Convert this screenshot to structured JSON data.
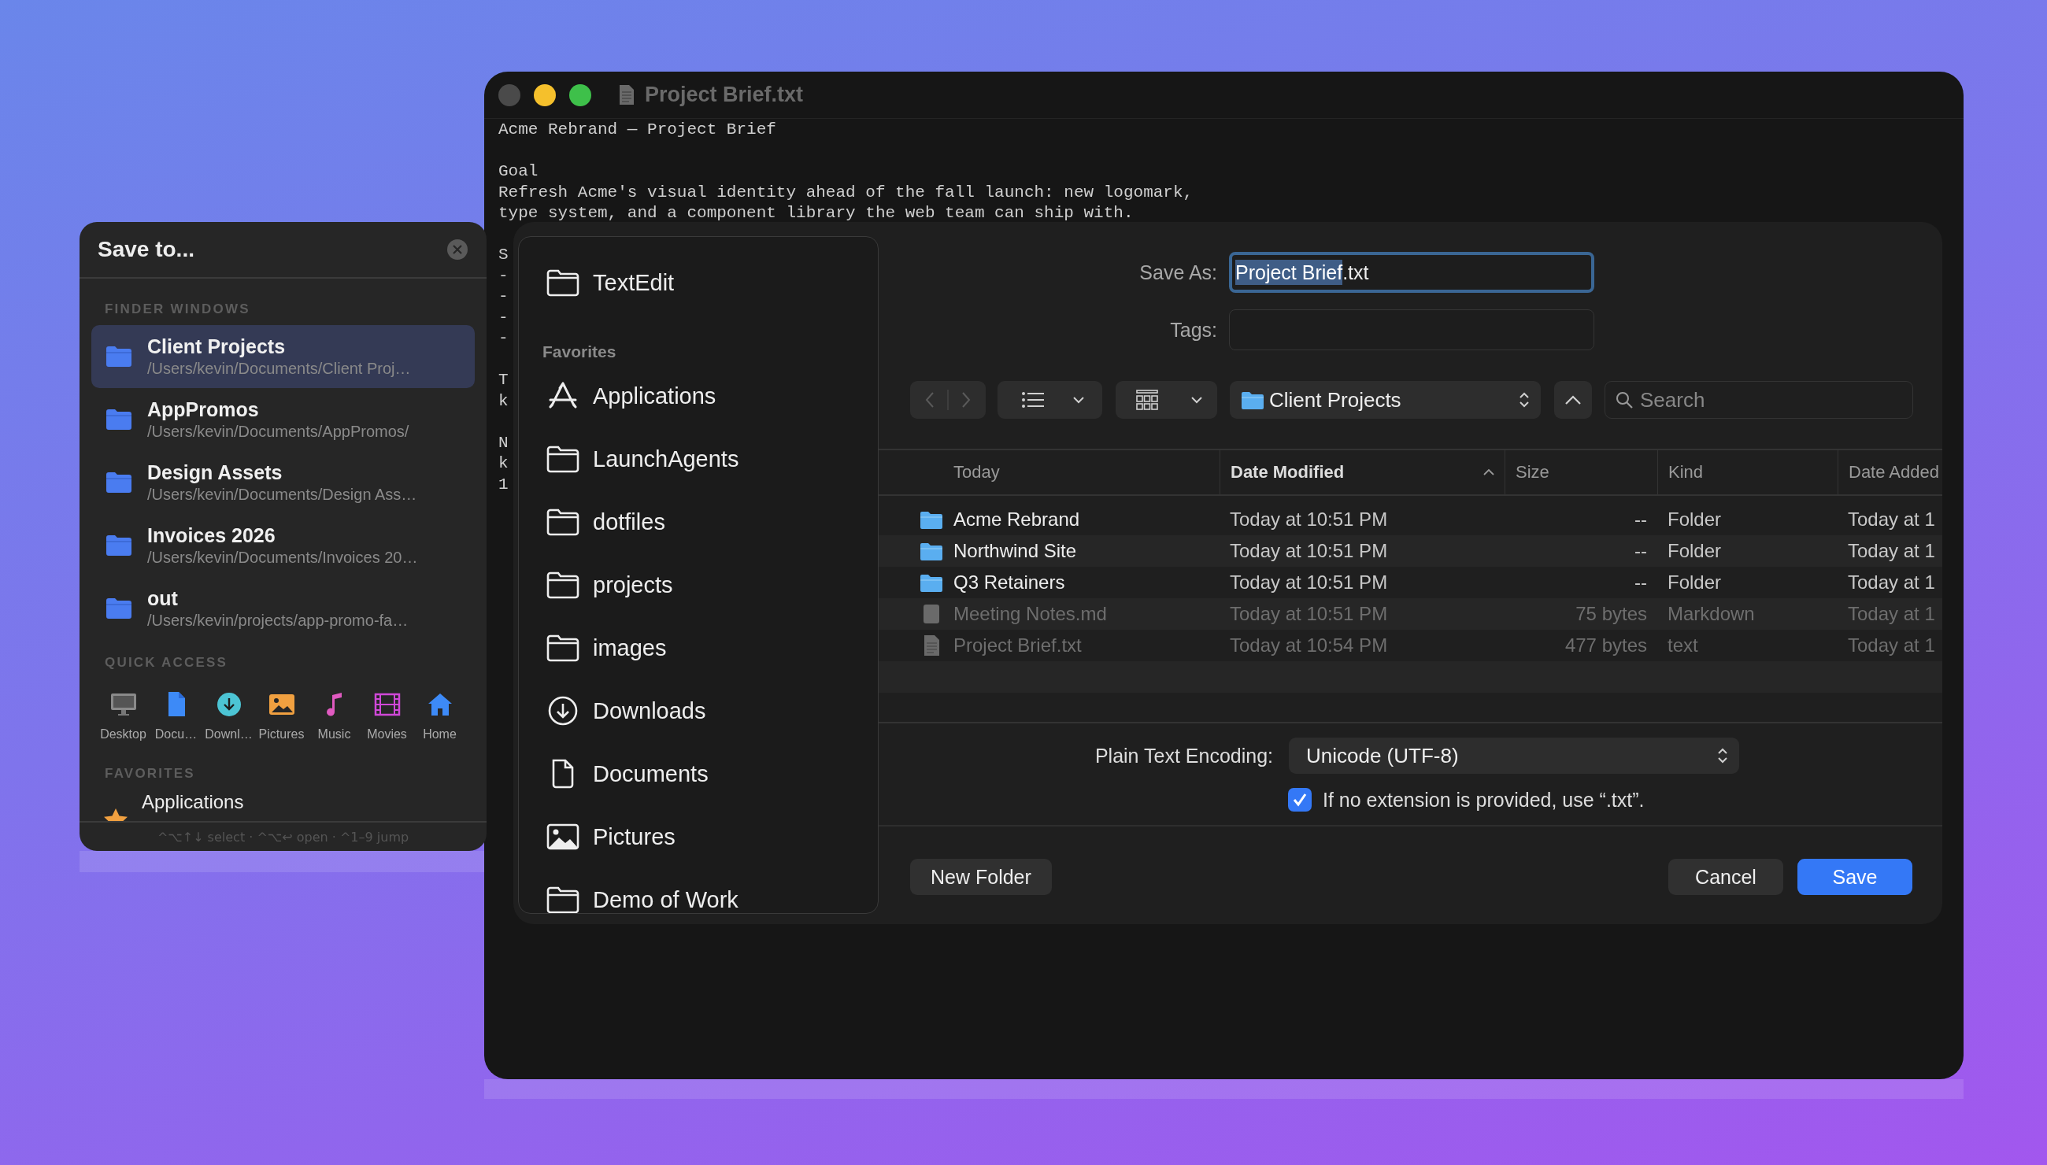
{
  "save_to_panel": {
    "title": "Save to...",
    "finder_windows": {
      "heading": "FINDER WINDOWS",
      "items": [
        {
          "name": "Client Projects",
          "path": "/Users/kevin/Documents/Client Proj…",
          "selected": true
        },
        {
          "name": "AppPromos",
          "path": "/Users/kevin/Documents/AppPromos/",
          "selected": false
        },
        {
          "name": "Design Assets",
          "path": "/Users/kevin/Documents/Design Ass…",
          "selected": false
        },
        {
          "name": "Invoices 2026",
          "path": "/Users/kevin/Documents/Invoices 20…",
          "selected": false
        },
        {
          "name": "out",
          "path": "/Users/kevin/projects/app-promo-fa…",
          "selected": false
        }
      ]
    },
    "quick_access": {
      "heading": "QUICK ACCESS",
      "items": [
        {
          "label": "Desktop",
          "kind": "desktop"
        },
        {
          "label": "Docu…",
          "kind": "documents"
        },
        {
          "label": "Downl…",
          "kind": "downloads"
        },
        {
          "label": "Pictures",
          "kind": "pictures"
        },
        {
          "label": "Music",
          "kind": "music"
        },
        {
          "label": "Movies",
          "kind": "movies"
        },
        {
          "label": "Home",
          "kind": "home"
        }
      ]
    },
    "favorites": {
      "heading": "FAVORITES",
      "items": [
        {
          "label": "Applications",
          "kind": "applications"
        }
      ]
    },
    "footer": "^⌥↑↓ select · ^⌥↩ open · ^1–9 jump"
  },
  "editor": {
    "traffic_lights": [
      {
        "color": "#4a4a4a"
      },
      {
        "color": "#f5c02c"
      },
      {
        "color": "#3ec04a"
      }
    ],
    "title": "Project Brief.txt",
    "paragraphs": [
      {
        "lines": [
          "Acme Rebrand — Project Brief"
        ]
      },
      {
        "lines": [
          "Goal",
          "Refresh Acme's visual identity ahead of the fall launch: new logomark,",
          "type system, and a component library the web team can ship with."
        ]
      },
      {
        "lines": [
          "S",
          "-",
          "-",
          "-",
          "-"
        ]
      },
      {
        "lines": [
          "T",
          "k"
        ]
      },
      {
        "lines": [
          "N",
          "k",
          "1"
        ]
      }
    ]
  },
  "save_sheet": {
    "sidebar": {
      "top_items": [
        {
          "label": "TextEdit",
          "kind": "folder"
        }
      ],
      "favorites": {
        "heading": "Favorites",
        "items": [
          {
            "label": "Applications",
            "kind": "applications"
          },
          {
            "label": "LaunchAgents",
            "kind": "folder"
          },
          {
            "label": "dotfiles",
            "kind": "folder"
          },
          {
            "label": "projects",
            "kind": "folder"
          },
          {
            "label": "images",
            "kind": "folder"
          },
          {
            "label": "Downloads",
            "kind": "downloads"
          },
          {
            "label": "Documents",
            "kind": "document"
          },
          {
            "label": "Pictures",
            "kind": "pictures"
          },
          {
            "label": "Demo of Work",
            "kind": "folder"
          }
        ]
      }
    },
    "save_as": {
      "label": "Save As:",
      "focused": true,
      "value_parts": [
        {
          "text": "Project Brief",
          "selected": true
        },
        {
          "text": ".txt",
          "selected": false
        }
      ]
    },
    "tags": {
      "label": "Tags:"
    },
    "toolbar": {
      "back_disabled": true,
      "forward_disabled": true,
      "location": "Client Projects",
      "search_placeholder": "Search"
    },
    "file_list": {
      "columns": [
        {
          "label": "Today",
          "sorted": false
        },
        {
          "label": "Date Modified",
          "sorted": true
        },
        {
          "label": "Size",
          "sorted": false
        },
        {
          "label": "Kind",
          "sorted": false
        },
        {
          "label": "Date Added",
          "sorted": false
        }
      ],
      "rows": [
        {
          "name": "Acme Rebrand",
          "kind": "folder",
          "disabled": false,
          "date_modified": "Today at 10:51 PM",
          "size": "--",
          "file_kind": "Folder",
          "date_added": "Today at 1"
        },
        {
          "name": "Northwind Site",
          "kind": "folder",
          "disabled": false,
          "date_modified": "Today at 10:51 PM",
          "size": "--",
          "file_kind": "Folder",
          "date_added": "Today at 1"
        },
        {
          "name": "Q3 Retainers",
          "kind": "folder",
          "disabled": false,
          "date_modified": "Today at 10:51 PM",
          "size": "--",
          "file_kind": "Folder",
          "date_added": "Today at 1"
        },
        {
          "name": "Meeting Notes.md",
          "kind": "markdown",
          "disabled": true,
          "date_modified": "Today at 10:51 PM",
          "size": "75 bytes",
          "file_kind": "Markdown",
          "date_added": "Today at 1"
        },
        {
          "name": "Project Brief.txt",
          "kind": "text",
          "disabled": true,
          "date_modified": "Today at 10:54 PM",
          "size": "477 bytes",
          "file_kind": "text",
          "date_added": "Today at 1"
        }
      ]
    },
    "encoding": {
      "label": "Plain Text Encoding:",
      "value": "Unicode (UTF-8)"
    },
    "extension_checkbox": {
      "label": "If no extension is provided, use “.txt”.",
      "checked": true
    },
    "buttons": [
      {
        "label": "New Folder",
        "kind": "secondary"
      },
      {
        "label": "Cancel",
        "kind": "secondary"
      },
      {
        "label": "Save",
        "kind": "primary"
      }
    ]
  }
}
